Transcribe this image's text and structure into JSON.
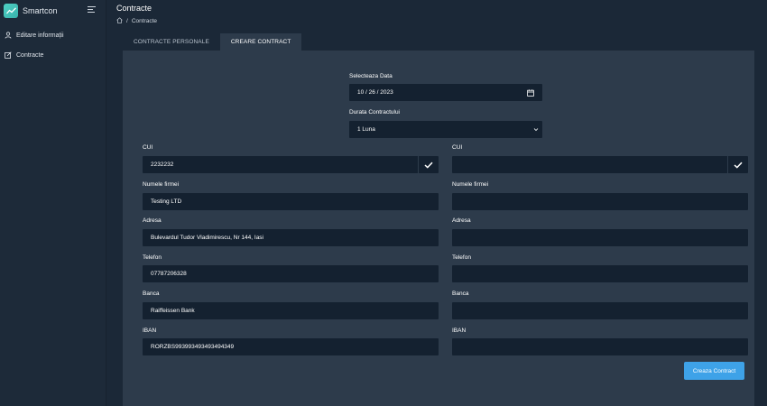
{
  "app": {
    "name": "Smartcon"
  },
  "sidebar": {
    "items": [
      {
        "label": "Editare informații",
        "icon": "user-icon"
      },
      {
        "label": "Contracte",
        "icon": "edit-icon"
      }
    ]
  },
  "header": {
    "title": "Contracte",
    "breadcrumb": {
      "current": "Contracte",
      "separator": "/"
    }
  },
  "tabs": [
    {
      "label": "CONTRACTE PERSONALE",
      "active": false
    },
    {
      "label": "CREARE CONTRACT",
      "active": true
    }
  ],
  "form": {
    "date": {
      "label": "Selecteaza Data",
      "value": "10 / 26 / 2023"
    },
    "duration": {
      "label": "Durata Contractului",
      "value": "1 Luna"
    },
    "left": {
      "cui": {
        "label": "CUI",
        "value": "2232232"
      },
      "company": {
        "label": "Numele firmei",
        "value": "Testing LTD"
      },
      "address": {
        "label": "Adresa",
        "value": "Bulevardul Tudor Vladimirescu, Nr 144, Iasi"
      },
      "phone": {
        "label": "Telefon",
        "value": "07787206328"
      },
      "bank": {
        "label": "Banca",
        "value": "Raiffeissen Bank"
      },
      "iban": {
        "label": "IBAN",
        "value": "RORZBS993993493493494349"
      }
    },
    "right": {
      "cui": {
        "label": "CUI",
        "value": ""
      },
      "company": {
        "label": "Numele firmei",
        "value": ""
      },
      "address": {
        "label": "Adresa",
        "value": ""
      },
      "phone": {
        "label": "Telefon",
        "value": ""
      },
      "bank": {
        "label": "Banca",
        "value": ""
      },
      "iban": {
        "label": "IBAN",
        "value": ""
      }
    },
    "submit_label": "Creaza Contract"
  },
  "colors": {
    "accent": "#3ea2e8",
    "panel": "#2d3b4b",
    "input": "#142130",
    "sidebar": "#1d2a39"
  }
}
